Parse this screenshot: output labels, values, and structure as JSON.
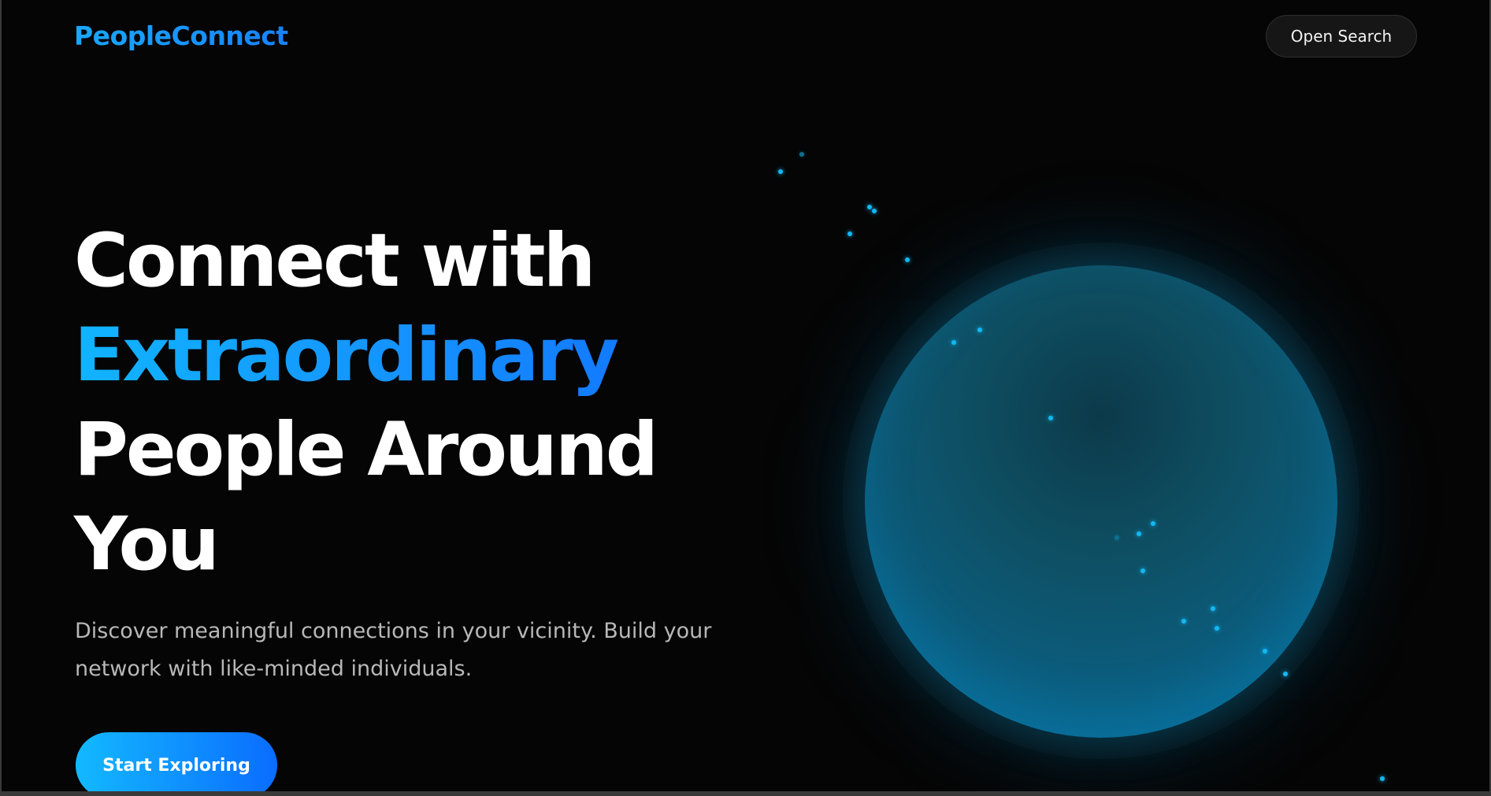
{
  "header": {
    "logo_text": "PeopleConnect",
    "search_button_label": "Open Search"
  },
  "hero": {
    "headline_line1": "Connect with",
    "headline_accent": "Extraordinary",
    "headline_line3": "People Around",
    "headline_line4": "You",
    "subtext": "Discover meaningful connections in your vicinity. Build your network with like-minded individuals.",
    "cta_label": "Start Exploring"
  },
  "colors": {
    "background": "#050505",
    "accent": "#1590ff",
    "accent_light": "#11b4ff",
    "globe": "#0b77a3"
  }
}
